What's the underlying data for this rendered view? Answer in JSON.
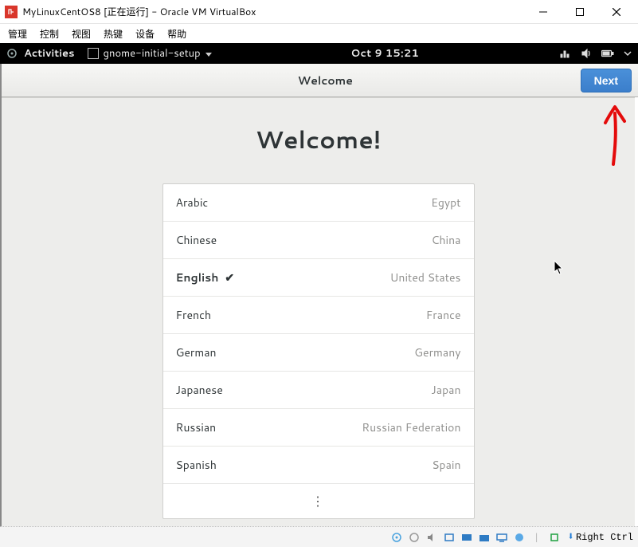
{
  "host": {
    "window_title": "MyLinuxCentOS8 [正在运行] - Oracle VM VirtualBox",
    "menubar": [
      "管理",
      "控制",
      "视图",
      "热键",
      "设备",
      "帮助"
    ],
    "hostkey_label": "Right Ctrl"
  },
  "gnome_topbar": {
    "activities": "Activities",
    "app_name": "gnome-initial-setup",
    "datetime": "Oct 9  15:21"
  },
  "headerbar": {
    "title": "Welcome",
    "next_label": "Next"
  },
  "setup": {
    "heading": "Welcome!",
    "languages": [
      {
        "name": "Arabic",
        "region": "Egypt",
        "selected": false
      },
      {
        "name": "Chinese",
        "region": "China",
        "selected": false
      },
      {
        "name": "English",
        "region": "United States",
        "selected": true
      },
      {
        "name": "French",
        "region": "France",
        "selected": false
      },
      {
        "name": "German",
        "region": "Germany",
        "selected": false
      },
      {
        "name": "Japanese",
        "region": "Japan",
        "selected": false
      },
      {
        "name": "Russian",
        "region": "Russian Federation",
        "selected": false
      },
      {
        "name": "Spanish",
        "region": "Spain",
        "selected": false
      }
    ],
    "more_glyph": "⋮"
  },
  "colors": {
    "primary_button": "#4a90d9",
    "gnome_bg": "#ededeb"
  }
}
